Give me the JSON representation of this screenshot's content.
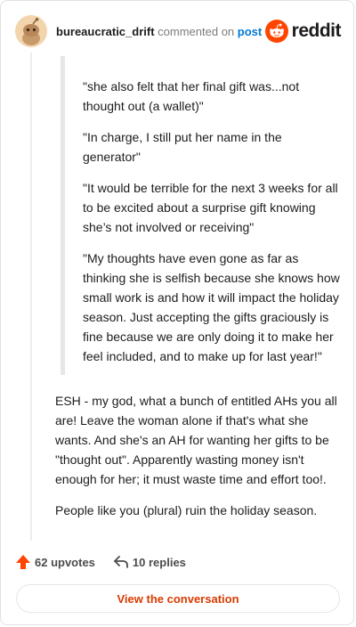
{
  "header": {
    "username": "bureaucratic_drift",
    "verb": "commented on",
    "post_link": "post",
    "brand": "reddit"
  },
  "quote": {
    "paragraphs": [
      "\"she also felt that her final gift was...not thought out (a wallet)\"",
      "\"In charge, I still put her name in the generator\"",
      "\"It would be terrible for the next 3 weeks for all to be excited about a surprise gift knowing she’s not involved or receiving\"",
      "\"My thoughts have even gone as far as thinking she is selfish because she knows how small work is and how it will impact the holiday season. Just accepting the gifts graciously is fine because we are only doing it to make her feel included, and to make up for last year!\""
    ]
  },
  "comment": {
    "paragraphs": [
      "ESH - my god, what a bunch of entitled AHs you all are! Leave the woman alone if that's what she wants. And she's an AH for wanting her gifts to be \"thought out\". Apparently wasting money isn't enough for her; it must waste time and effort too!.",
      "People like you (plural) ruin the holiday season."
    ]
  },
  "actions": {
    "upvotes": "62 upvotes",
    "replies": "10 replies"
  },
  "footer": {
    "view_label": "View the conversation"
  },
  "colors": {
    "brand_orange": "#ff4500",
    "link_blue": "#0079d3",
    "button_text": "#d93a00"
  },
  "icons": {
    "avatar": "snoo-avatar-icon",
    "brand": "reddit-logo-icon",
    "upvote": "upvote-arrow-icon",
    "reply": "reply-arrow-icon"
  }
}
